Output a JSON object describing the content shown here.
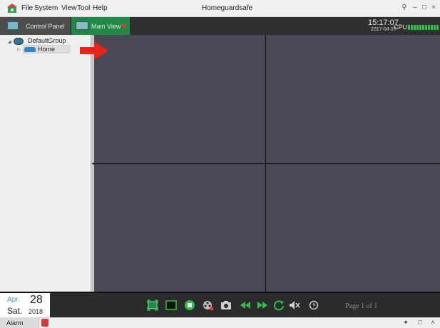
{
  "menubar": {
    "items": [
      "File",
      "System",
      "View",
      "Tool",
      "Help"
    ],
    "title": "Homeguardsafe",
    "window_controls": [
      "lock-icon",
      "minimize-icon",
      "maximize-icon",
      "close-icon"
    ]
  },
  "tabs": [
    {
      "label": "Control Panel",
      "icon": "control-panel-icon",
      "active": false
    },
    {
      "label": "Main View",
      "icon": "monitor-icon",
      "active": true
    }
  ],
  "status": {
    "time": "15:17:07",
    "date": "2017-04-27",
    "cpu_label": "CPU",
    "cpu_color": "#2ec04b"
  },
  "tree": {
    "group": "DefaultGroup",
    "device": "Home"
  },
  "calendar": {
    "month": "Apr.",
    "day": "28",
    "weekday": "Sat.",
    "year": "2018"
  },
  "toolbar": {
    "tools": [
      "fullscreen-icon",
      "single-view-icon",
      "stop-icon",
      "record-icon",
      "snapshot-icon",
      "rewind-icon",
      "forward-icon",
      "refresh-icon",
      "mute-icon",
      "clock-icon"
    ],
    "page_label": "Page 1 of 1"
  },
  "statusbar": {
    "alarm_label": "Alarm"
  },
  "colors": {
    "accent": "#1f8a46",
    "video_bg": "#4a4856",
    "arrow": "#e8231c"
  }
}
